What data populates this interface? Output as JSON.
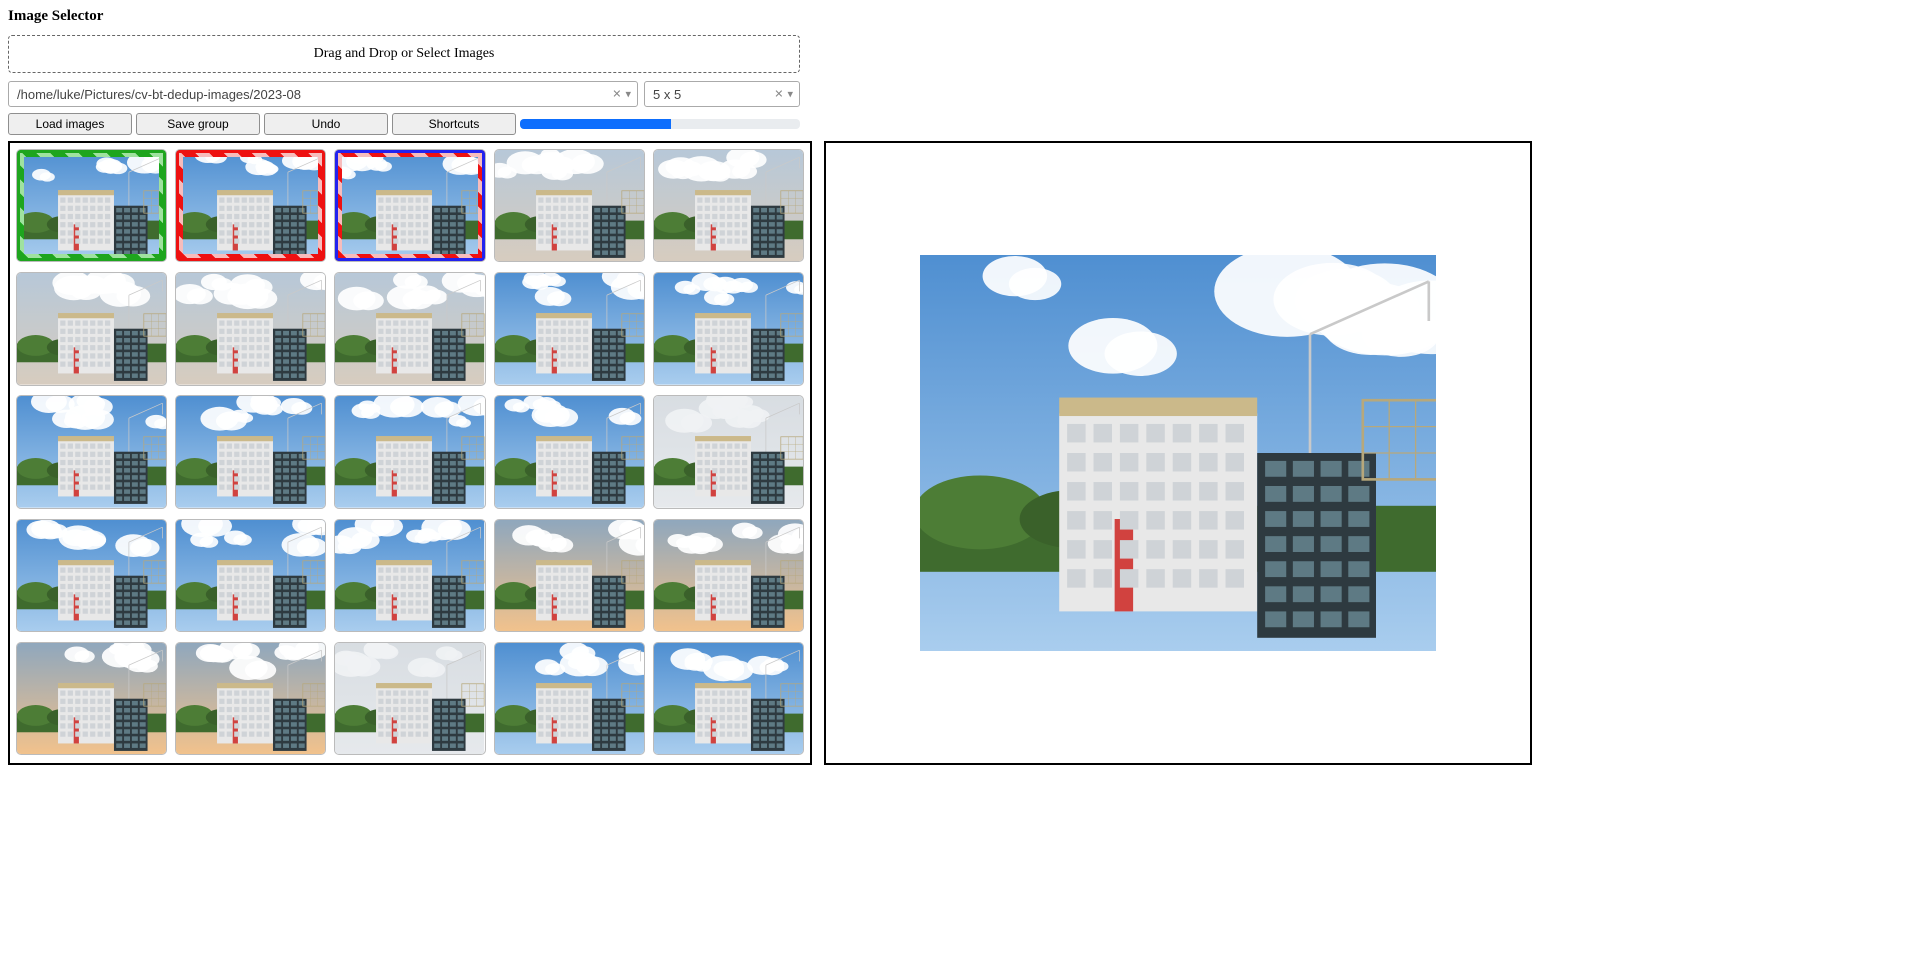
{
  "title": "Image Selector",
  "dropzone_text": "Drag and Drop or Select Images",
  "path_select": {
    "value": "/home/luke/Pictures/cv-bt-dedup-images/2023-08"
  },
  "grid_select": {
    "value": "5 x 5"
  },
  "buttons": {
    "load": "Load images",
    "save": "Save group",
    "undo": "Undo",
    "shortcuts": "Shortcuts"
  },
  "progress_percent": 54,
  "grid": {
    "rows": 5,
    "cols": 5,
    "cells": [
      {
        "sky": "day",
        "selection": "keep-primary"
      },
      {
        "sky": "day",
        "selection": "discard"
      },
      {
        "sky": "day",
        "selection": "discard-focus"
      },
      {
        "sky": "dusk",
        "selection": "none"
      },
      {
        "sky": "dusk",
        "selection": "none"
      },
      {
        "sky": "dusk",
        "selection": "none"
      },
      {
        "sky": "dusk",
        "selection": "none"
      },
      {
        "sky": "dusk",
        "selection": "none"
      },
      {
        "sky": "day",
        "selection": "none"
      },
      {
        "sky": "day",
        "selection": "none"
      },
      {
        "sky": "day",
        "selection": "none"
      },
      {
        "sky": "day",
        "selection": "none"
      },
      {
        "sky": "day",
        "selection": "none"
      },
      {
        "sky": "day",
        "selection": "none"
      },
      {
        "sky": "overcast",
        "selection": "none"
      },
      {
        "sky": "day",
        "selection": "none"
      },
      {
        "sky": "day",
        "selection": "none"
      },
      {
        "sky": "day",
        "selection": "none"
      },
      {
        "sky": "sunset",
        "selection": "none"
      },
      {
        "sky": "sunset",
        "selection": "none"
      },
      {
        "sky": "sunset",
        "selection": "none"
      },
      {
        "sky": "sunset",
        "selection": "none"
      },
      {
        "sky": "overcast",
        "selection": "none"
      },
      {
        "sky": "day",
        "selection": "none"
      },
      {
        "sky": "day",
        "selection": "none"
      }
    ]
  },
  "preview": {
    "sky": "day"
  },
  "colors": {
    "keep": "#1ea51e",
    "discard": "#e11",
    "focus": "#2222ee",
    "progress": "#0d6efd"
  }
}
